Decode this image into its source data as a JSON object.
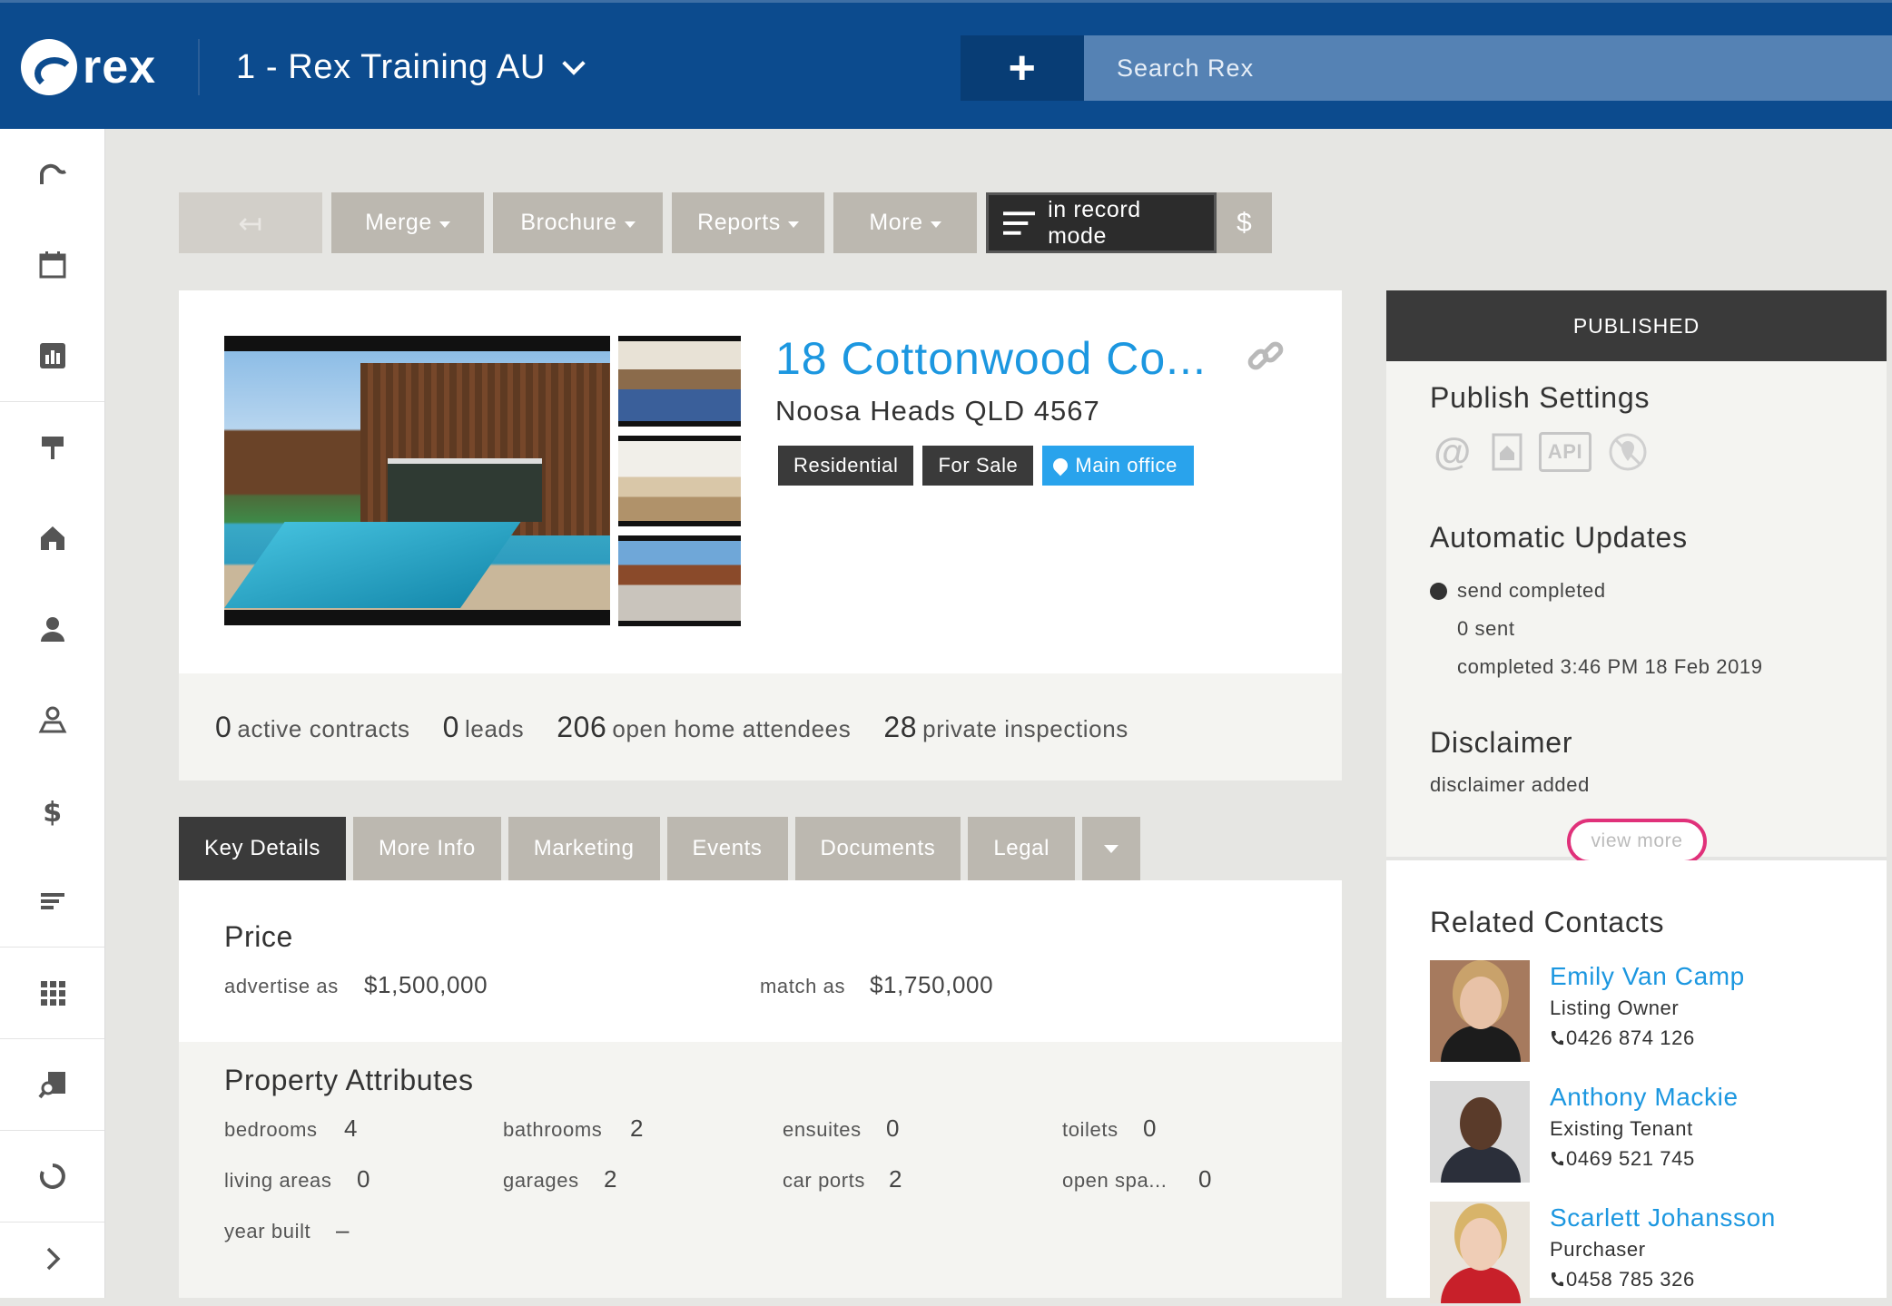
{
  "header": {
    "logo_text": "rex",
    "account_name": "1 - Rex Training AU",
    "search_placeholder": "Search Rex",
    "add_label": "+"
  },
  "sidebar": {
    "items": [
      "rex-home-icon",
      "calendar-icon",
      "chart-icon",
      "signpost-icon",
      "house-icon",
      "person-icon",
      "map-contact-icon",
      "dollar-icon",
      "list-icon",
      "apps-grid-icon",
      "search-property-icon",
      "loading-icon",
      "chevron-right-icon"
    ]
  },
  "toolbar": {
    "back_label": "↤",
    "merge": "Merge",
    "brochure": "Brochure",
    "reports": "Reports",
    "more": "More",
    "record_mode": "in record mode",
    "dollar": "$"
  },
  "listing": {
    "title": "18 Cottonwood Co...",
    "address": "Noosa Heads QLD 4567",
    "tags": [
      "Residential",
      "For Sale",
      "Main office"
    ]
  },
  "stats": [
    {
      "num": "0",
      "label": "active contracts"
    },
    {
      "num": "0",
      "label": "leads"
    },
    {
      "num": "206",
      "label": "open home attendees"
    },
    {
      "num": "28",
      "label": "private inspections"
    }
  ],
  "tabs": [
    "Key Details",
    "More Info",
    "Marketing",
    "Events",
    "Documents",
    "Legal"
  ],
  "price": {
    "heading": "Price",
    "advertise_label": "advertise as",
    "advertise_value": "$1,500,000",
    "match_label": "match as",
    "match_value": "$1,750,000"
  },
  "attributes": {
    "heading": "Property Attributes",
    "items": [
      {
        "label": "bedrooms",
        "value": "4"
      },
      {
        "label": "bathrooms",
        "value": "2"
      },
      {
        "label": "ensuites",
        "value": "0"
      },
      {
        "label": "toilets",
        "value": "0"
      },
      {
        "label": "living areas",
        "value": "0"
      },
      {
        "label": "garages",
        "value": "2"
      },
      {
        "label": "car ports",
        "value": "2"
      },
      {
        "label": "open spa...",
        "value": "0"
      },
      {
        "label": "year built",
        "value": "–"
      }
    ]
  },
  "right_panel": {
    "status": "PUBLISHED",
    "publish_heading": "Publish Settings",
    "publish_icons": [
      "@",
      "API"
    ],
    "auto_heading": "Automatic Updates",
    "send_status": "send completed",
    "sent": "0 sent",
    "completed": "completed 3:46 PM 18 Feb 2019",
    "disclaimer_heading": "Disclaimer",
    "disclaimer_text": "disclaimer added",
    "view_more": "view more",
    "related_heading": "Related Contacts",
    "contacts": [
      {
        "name": "Emily Van Camp",
        "role": "Listing Owner",
        "phone": "0426 874 126"
      },
      {
        "name": "Anthony Mackie",
        "role": "Existing Tenant",
        "phone": "0469 521 745"
      },
      {
        "name": "Scarlett Johansson",
        "role": "Purchaser",
        "phone": "0458 785 326"
      }
    ]
  },
  "colors": {
    "header": "#0c4b8e",
    "accent": "#1c97e0",
    "highlight": "#e0317a",
    "dark": "#3a3a3a"
  }
}
